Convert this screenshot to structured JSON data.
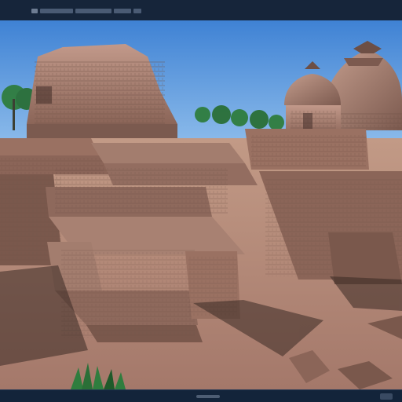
{
  "window": {
    "menu_items": [
      "",
      "",
      "",
      "",
      ""
    ],
    "status_text": ""
  },
  "scene": {
    "icons": [
      "temple-ruins-render",
      "tree-icon",
      "stupa-dome-icon",
      "shrine-icon",
      "grass-tuft-icon"
    ],
    "colors": {
      "sky_top": "#3f82d4",
      "sky_bottom": "#9cc7ef",
      "stone_light": "#b58a76",
      "stone_mid": "#8f6a5b",
      "stone_dark": "#5f4338",
      "ground": "#b88a73",
      "shadow": "#3a2a24",
      "foliage": "#2f7d3e",
      "foliage_dark": "#1f5a2a",
      "window_bar": "#16253a"
    }
  }
}
